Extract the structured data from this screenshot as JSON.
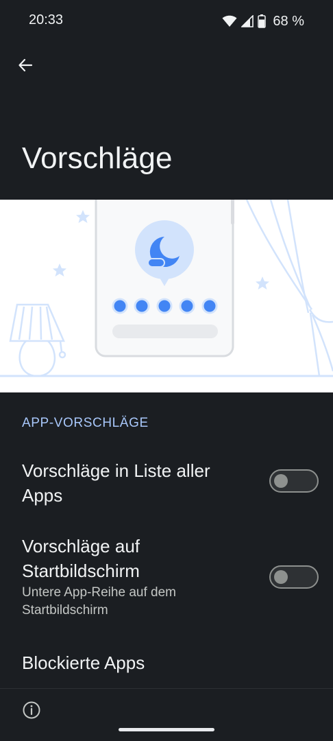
{
  "status_bar": {
    "time": "20:33",
    "battery": "68 %"
  },
  "page": {
    "title": "Vorschläge"
  },
  "section": {
    "header": "APP-VORSCHLÄGE"
  },
  "preferences": [
    {
      "title": "Vorschläge in Liste aller Apps",
      "enabled": false
    },
    {
      "title": "Vorschläge auf Startbildschirm",
      "summary": "Untere App-Reihe auf dem Startbildschirm",
      "enabled": false
    },
    {
      "title": "Blockierte Apps"
    }
  ],
  "icons": {
    "back": "arrow-back-icon",
    "info": "info-icon",
    "wifi": "wifi-icon",
    "signal": "cell-signal-icon",
    "battery": "battery-icon",
    "suggestion": "moon-sleep-icon"
  },
  "colors": {
    "background": "#1b1e22",
    "accent": "#a8c7fa",
    "illustration_blue": "#4285f4"
  }
}
